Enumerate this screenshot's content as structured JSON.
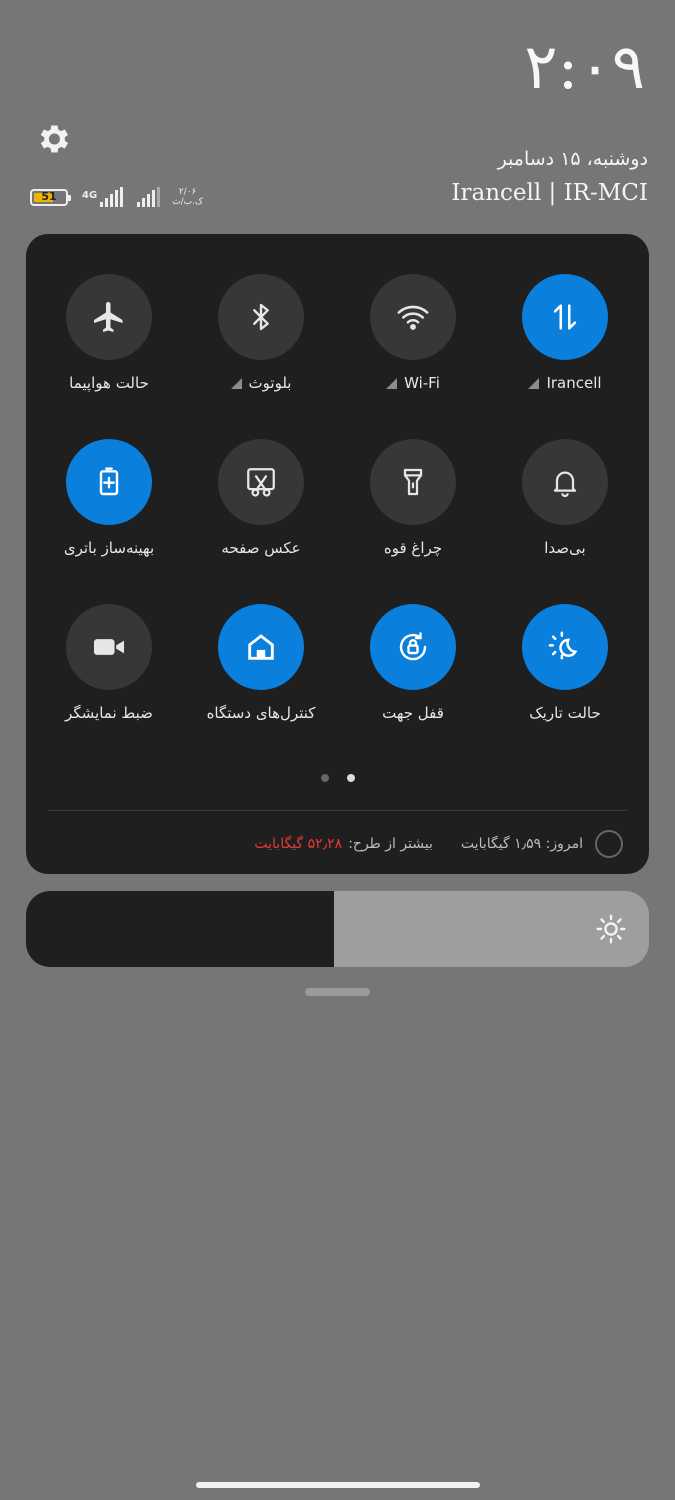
{
  "header": {
    "time": "۲:۰۹",
    "date": "دوشنبه، ۱۵ دسامبر",
    "carriers": "Irancell | IR-MCI"
  },
  "status_bar": {
    "battery_level": "51",
    "network_type": "4G",
    "data_speed_value": "۲/۰۶",
    "data_speed_unit": "ک.ب/ث"
  },
  "toggles": [
    {
      "label": "Irancell",
      "icon": "data-transfer-icon",
      "active": true,
      "has_arrow": true
    },
    {
      "label": "Wi-Fi",
      "icon": "wifi-icon",
      "active": false,
      "has_arrow": true
    },
    {
      "label": "بلوتوث",
      "icon": "bluetooth-icon",
      "active": false,
      "has_arrow": true
    },
    {
      "label": "حالت هواپیما",
      "icon": "airplane-icon",
      "active": false,
      "has_arrow": false
    },
    {
      "label": "بی‌صدا",
      "icon": "bell-icon",
      "active": false,
      "has_arrow": false
    },
    {
      "label": "چراغ قوه",
      "icon": "flashlight-icon",
      "active": false,
      "has_arrow": false
    },
    {
      "label": "عکس صفحه",
      "icon": "screenshot-scissors-icon",
      "active": false,
      "has_arrow": false
    },
    {
      "label": "بهینه‌ساز باتری",
      "icon": "battery-saver-icon",
      "active": true,
      "has_arrow": false
    },
    {
      "label": "حالت تاریک",
      "icon": "dark-mode-icon",
      "active": true,
      "has_arrow": false
    },
    {
      "label": "قفل جهت",
      "icon": "rotation-lock-icon",
      "active": true,
      "has_arrow": false
    },
    {
      "label": "کنترل‌های دستگاه",
      "icon": "home-icon",
      "active": true,
      "has_arrow": false
    },
    {
      "label": "ضبط نمایشگر",
      "icon": "video-camera-icon",
      "active": false,
      "has_arrow": false
    }
  ],
  "pager": {
    "pages": 2,
    "current": 2
  },
  "data_usage": {
    "today": "امروز: ۱٫۵۹ گیگابایت",
    "remaining_label": "بیشتر از طرح:",
    "remaining_value": "۵۲٫۲۸ گیگابایت",
    "remaining_color": "#e53935"
  },
  "brightness": {
    "level": 0.5,
    "icon": "sun-icon"
  },
  "colors": {
    "accent": "#0a7fdc",
    "panel": "#1f1f20",
    "background": "#767676"
  }
}
